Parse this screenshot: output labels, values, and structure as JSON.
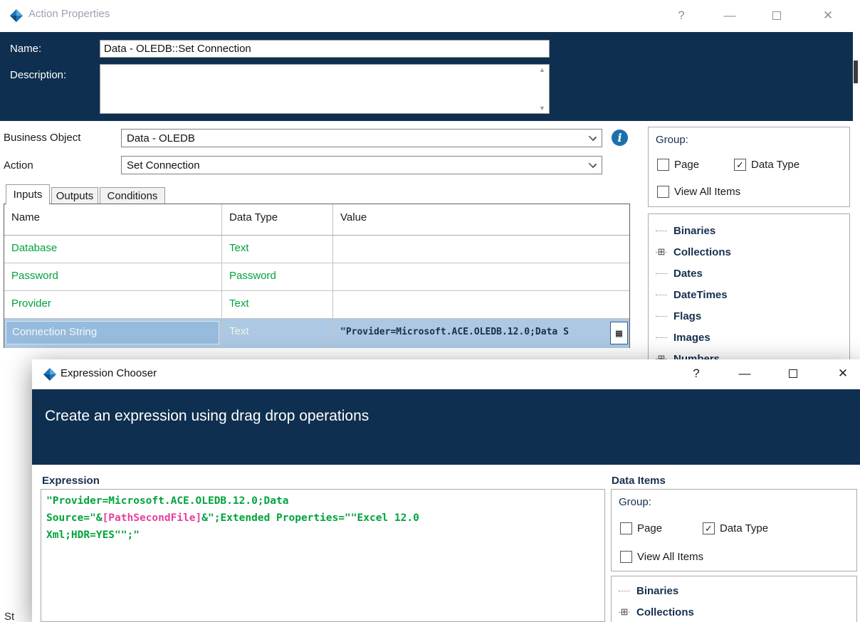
{
  "colors": {
    "navy": "#0e2f4f",
    "green": "#00a33d",
    "pink": "#e93f9b",
    "row-selection": "#adc8e2",
    "tree-text": "#17304f"
  },
  "main_window": {
    "title": "Action Properties",
    "titlebar": {
      "help": "?",
      "minimize": "—",
      "close": "✕"
    },
    "fields": {
      "name_label": "Name:",
      "name_value": "Data - OLEDB::Set Connection",
      "description_label": "Description:",
      "description_value": ""
    },
    "business_object": {
      "label": "Business Object",
      "value": "Data - OLEDB"
    },
    "action": {
      "label": "Action",
      "value": "Set Connection"
    },
    "tabs": [
      {
        "label": "Inputs"
      },
      {
        "label": "Outputs"
      },
      {
        "label": "Conditions"
      }
    ],
    "inputs_table": {
      "columns": [
        "Name",
        "Data Type",
        "Value"
      ],
      "rows": [
        {
          "name": "Database",
          "type": "Text",
          "value": ""
        },
        {
          "name": "Password",
          "type": "Password",
          "value": ""
        },
        {
          "name": "Provider",
          "type": "Text",
          "value": ""
        },
        {
          "name": "Connection String",
          "type": "Text",
          "value": "\"Provider=Microsoft.ACE.OLEDB.12.0;Data S"
        }
      ]
    },
    "calc_icon": "▦",
    "group_panel": {
      "label": "Group:",
      "checkboxes": [
        {
          "label": "Page",
          "mark": ""
        },
        {
          "label": "Data Type",
          "mark": "✓"
        },
        {
          "label": "View All Items",
          "mark": ""
        }
      ]
    },
    "tree": {
      "items": [
        {
          "label": "Binaries",
          "expander": ""
        },
        {
          "label": "Collections",
          "expander": "⊞"
        },
        {
          "label": "Dates",
          "expander": ""
        },
        {
          "label": "DateTimes",
          "expander": ""
        },
        {
          "label": "Flags",
          "expander": ""
        },
        {
          "label": "Images",
          "expander": ""
        },
        {
          "label": "Numbers",
          "expander": "⊞"
        }
      ]
    },
    "partial_bottom_label": "St"
  },
  "expression_dialog": {
    "title": "Expression Chooser",
    "titlebar": {
      "help": "?",
      "minimize": "—",
      "close": "✕"
    },
    "banner": "Create an expression using drag drop operations",
    "expression_label": "Expression",
    "expression": {
      "line1": "\"Provider=Microsoft.ACE.OLEDB.12.0;Data",
      "line2_pre": "Source=\"&",
      "line2_item": "[PathSecondFile]",
      "line2_post": "&\";Extended Properties=\"\"Excel 12.0",
      "line3": "Xml;HDR=YES\"\";\""
    },
    "data_items_label": "Data Items",
    "group_panel": {
      "label": "Group:",
      "checkboxes": [
        {
          "label": "Page",
          "mark": ""
        },
        {
          "label": "Data Type",
          "mark": "✓"
        },
        {
          "label": "View All Items",
          "mark": ""
        }
      ]
    },
    "tree": {
      "items": [
        {
          "label": "Binaries",
          "expander": ""
        },
        {
          "label": "Collections",
          "expander": "⊞"
        }
      ]
    }
  }
}
